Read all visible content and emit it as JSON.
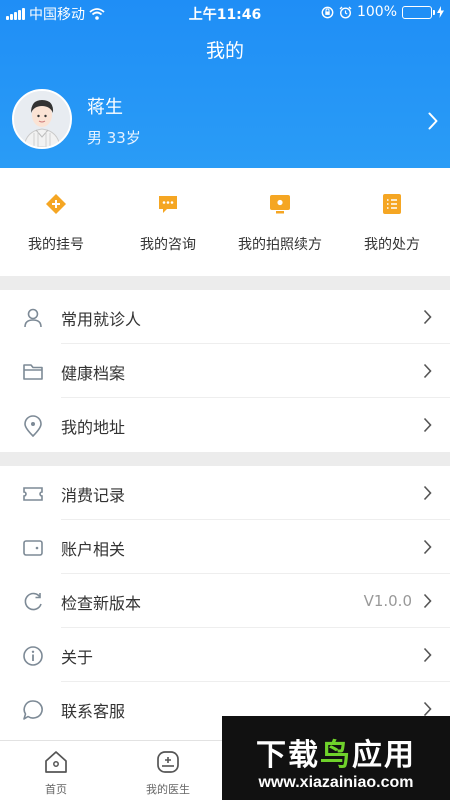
{
  "status_bar": {
    "carrier": "中国移动",
    "time": "上午11:46",
    "battery": "100%"
  },
  "nav": {
    "title": "我的"
  },
  "profile": {
    "name": "蒋生",
    "meta": "男 33岁"
  },
  "quick_actions": [
    {
      "label": "我的挂号",
      "icon": "registration-icon"
    },
    {
      "label": "我的咨询",
      "icon": "consult-chat-icon"
    },
    {
      "label": "我的拍照续方",
      "icon": "photo-prescription-icon"
    },
    {
      "label": "我的处方",
      "icon": "prescription-list-icon"
    }
  ],
  "menu_group_1": [
    {
      "label": "常用就诊人",
      "icon": "person-icon"
    },
    {
      "label": "健康档案",
      "icon": "folder-icon"
    },
    {
      "label": "我的地址",
      "icon": "location-icon"
    }
  ],
  "menu_group_2": [
    {
      "label": "消费记录",
      "icon": "ticket-icon"
    },
    {
      "label": "账户相关",
      "icon": "wallet-icon"
    },
    {
      "label": "检查新版本",
      "icon": "refresh-icon",
      "value": "V1.0.0"
    },
    {
      "label": "关于",
      "icon": "info-icon"
    },
    {
      "label": "联系客服",
      "icon": "chat-bubble-icon"
    }
  ],
  "tabbar": [
    {
      "label": "首页",
      "icon": "home-icon"
    },
    {
      "label": "我的医生",
      "icon": "doctor-icon"
    }
  ],
  "watermark": {
    "main_black": "下载",
    "main_green": "鸟",
    "main_rest": "应用",
    "url": "www.xiazainiao.com"
  },
  "colors": {
    "primary": "#1f8ef6",
    "accent_orange": "#f5a623",
    "battery_green": "#4cd964",
    "watermark_green": "#6fd22b"
  }
}
